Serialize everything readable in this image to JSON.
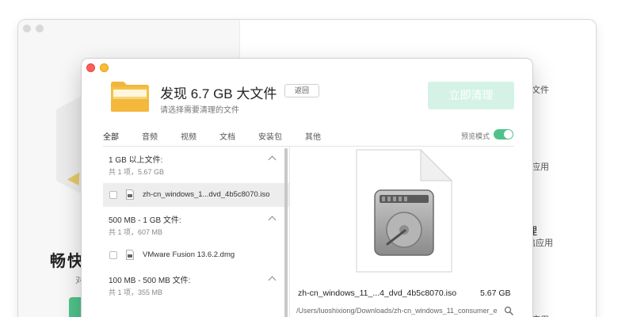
{
  "background": {
    "headline": "畅快",
    "subline": "对",
    "right_texts": [
      "?",
      "文件",
      "应用",
      "理",
      "启应用",
      "应用"
    ]
  },
  "dialog": {
    "title": "发现 6.7 GB 大文件",
    "back_label": "返回",
    "subtitle": "请选择需要清理的文件",
    "clean_label": "立即清理",
    "icons": {
      "folder": "folder-icon",
      "disk": "hard-disk-icon",
      "search": "search-icon"
    },
    "colors": {
      "accent": "#4fc28a",
      "clean_button": "#d4f3e6",
      "close": "#fc5f57",
      "minimize": "#fdbc2e"
    },
    "tabs": [
      {
        "label": "全部",
        "active": true
      },
      {
        "label": "音频",
        "active": false
      },
      {
        "label": "视频",
        "active": false
      },
      {
        "label": "文档",
        "active": false
      },
      {
        "label": "安装包",
        "active": false
      },
      {
        "label": "其他",
        "active": false
      }
    ],
    "preview_mode_label": "预览模式",
    "preview_mode_on": true,
    "groups": [
      {
        "title": "1 GB 以上文件:",
        "count": "共 1 项，5.67 GB",
        "file": "zh-cn_windows_1...dvd_4b5c8070.iso"
      },
      {
        "title": "500 MB - 1 GB 文件:",
        "count": "共 1 项，607 MB",
        "file": "VMware Fusion 13.6.2.dmg"
      },
      {
        "title": "100 MB - 500 MB 文件:",
        "count": "共 1 项，355 MB"
      }
    ],
    "preview": {
      "name": "zh-cn_windows_11_...4_dvd_4b5c8070.iso",
      "size": "5.67 GB",
      "path": "/Users/luoshixiong/Downloads/zh-cn_windows_11_consumer_e"
    }
  }
}
